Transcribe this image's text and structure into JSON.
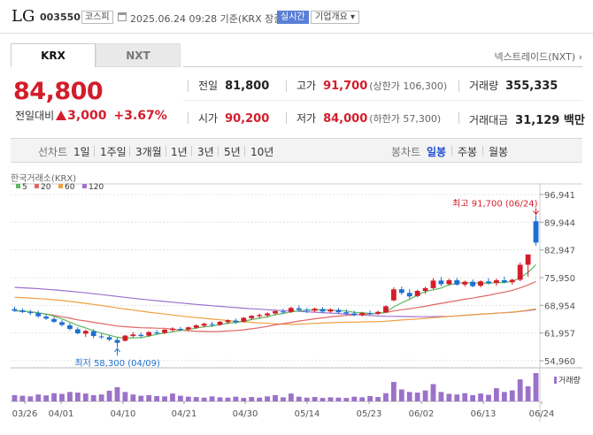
{
  "header": {
    "company_name": "LG",
    "stock_code": "003550",
    "market": "코스피",
    "datetime": "2025.06.24 09:28 기준(KRX 장중)",
    "realtime_label": "실시간",
    "overview_label": "기업개요 ▾"
  },
  "tabs": [
    {
      "label": "KRX",
      "active": true
    },
    {
      "label": "NXT",
      "active": false
    }
  ],
  "nxt_link": "넥스트레이드(NXT) ›",
  "quote": {
    "price": "84,800",
    "change_label": "전일대비",
    "change": "3,000",
    "change_pct": "+3.67%"
  },
  "stats": {
    "prev_close": {
      "label": "전일",
      "value": "81,800"
    },
    "high": {
      "label": "고가",
      "value": "91,700",
      "sub": "(상한가 106,300)"
    },
    "volume": {
      "label": "거래량",
      "value": "355,335"
    },
    "open": {
      "label": "시가",
      "value": "90,200"
    },
    "low": {
      "label": "저가",
      "value": "84,000",
      "sub": "(하한가 57,300)"
    },
    "trade_value": {
      "label": "거래대금",
      "value": "31,129 백만"
    }
  },
  "period_bar": {
    "line_label": "선차트",
    "line_periods": [
      "1일",
      "1주일",
      "3개월",
      "1년",
      "3년",
      "5년",
      "10년"
    ],
    "candle_label": "봉차트",
    "candle_periods": [
      "일봉",
      "주봉",
      "월봉"
    ],
    "candle_active": "일봉"
  },
  "colors": {
    "up": "#d31d2b",
    "down": "#1d6fd1",
    "ma5": "#5cb85c",
    "ma20": "#e06666",
    "ma60": "#f0a040",
    "ma120": "#a070d0",
    "volume": "#9b72c8"
  },
  "chart_data": {
    "type": "candlestick",
    "title": "한국거래소(KRX)",
    "legend": [
      "5",
      "20",
      "60",
      "120"
    ],
    "y_ticks": [
      "96,941",
      "89,944",
      "82,947",
      "75,950",
      "68,954",
      "61,957",
      "54,960"
    ],
    "ylim": [
      54960,
      96941
    ],
    "x_tick_labels": [
      "03/26",
      "04/01",
      "04/10",
      "04/21",
      "04/30",
      "05/14",
      "05/23",
      "06/02",
      "06/13",
      "06/24"
    ],
    "high_annotation": "최고 91,700 (06/24)",
    "low_annotation": "최저 58,300 (04/09)",
    "volume_label": "거래량",
    "candles": [
      {
        "o": 68000,
        "h": 68600,
        "l": 67300,
        "c": 67600
      },
      {
        "o": 67700,
        "h": 68200,
        "l": 67000,
        "c": 67300
      },
      {
        "o": 67200,
        "h": 67800,
        "l": 66500,
        "c": 67100
      },
      {
        "o": 67000,
        "h": 67600,
        "l": 65800,
        "c": 66200
      },
      {
        "o": 66100,
        "h": 66800,
        "l": 65300,
        "c": 65600
      },
      {
        "o": 65500,
        "h": 66000,
        "l": 64500,
        "c": 64800
      },
      {
        "o": 64700,
        "h": 65300,
        "l": 63600,
        "c": 64000
      },
      {
        "o": 63900,
        "h": 64500,
        "l": 62600,
        "c": 63000
      },
      {
        "o": 62900,
        "h": 63400,
        "l": 61600,
        "c": 61900
      },
      {
        "o": 61800,
        "h": 62800,
        "l": 61000,
        "c": 62500
      },
      {
        "o": 62400,
        "h": 62900,
        "l": 60700,
        "c": 61200
      },
      {
        "o": 61100,
        "h": 61800,
        "l": 60500,
        "c": 61000
      },
      {
        "o": 60900,
        "h": 61400,
        "l": 59900,
        "c": 60300
      },
      {
        "o": 60200,
        "h": 60800,
        "l": 58300,
        "c": 59500
      },
      {
        "o": 60000,
        "h": 61500,
        "l": 59800,
        "c": 61300
      },
      {
        "o": 61200,
        "h": 62200,
        "l": 60800,
        "c": 61600
      },
      {
        "o": 61500,
        "h": 62100,
        "l": 60700,
        "c": 61200
      },
      {
        "o": 61300,
        "h": 62400,
        "l": 61000,
        "c": 62200
      },
      {
        "o": 62100,
        "h": 62700,
        "l": 61500,
        "c": 62000
      },
      {
        "o": 62000,
        "h": 63000,
        "l": 61700,
        "c": 62800
      },
      {
        "o": 62700,
        "h": 63400,
        "l": 62200,
        "c": 63100
      },
      {
        "o": 63000,
        "h": 63500,
        "l": 62400,
        "c": 62900
      },
      {
        "o": 62900,
        "h": 63600,
        "l": 62500,
        "c": 63400
      },
      {
        "o": 63300,
        "h": 64200,
        "l": 63000,
        "c": 63900
      },
      {
        "o": 63800,
        "h": 64600,
        "l": 63400,
        "c": 64300
      },
      {
        "o": 64200,
        "h": 64800,
        "l": 63500,
        "c": 64000
      },
      {
        "o": 64000,
        "h": 65000,
        "l": 63800,
        "c": 64800
      },
      {
        "o": 64700,
        "h": 65400,
        "l": 64200,
        "c": 65200
      },
      {
        "o": 65100,
        "h": 65600,
        "l": 64300,
        "c": 64700
      },
      {
        "o": 64800,
        "h": 66000,
        "l": 64600,
        "c": 65800
      },
      {
        "o": 65700,
        "h": 66500,
        "l": 65200,
        "c": 66300
      },
      {
        "o": 66200,
        "h": 66900,
        "l": 65700,
        "c": 66500
      },
      {
        "o": 66400,
        "h": 67200,
        "l": 66000,
        "c": 66900
      },
      {
        "o": 66900,
        "h": 67800,
        "l": 66500,
        "c": 67500
      },
      {
        "o": 67400,
        "h": 68100,
        "l": 66800,
        "c": 67300
      },
      {
        "o": 67300,
        "h": 68600,
        "l": 67000,
        "c": 68300
      },
      {
        "o": 68200,
        "h": 68900,
        "l": 67500,
        "c": 67800
      },
      {
        "o": 67800,
        "h": 68300,
        "l": 67000,
        "c": 67600
      },
      {
        "o": 67600,
        "h": 68400,
        "l": 67200,
        "c": 68100
      },
      {
        "o": 68000,
        "h": 68500,
        "l": 67000,
        "c": 67400
      },
      {
        "o": 67400,
        "h": 68200,
        "l": 67100,
        "c": 67900
      },
      {
        "o": 67800,
        "h": 68300,
        "l": 66900,
        "c": 67200
      },
      {
        "o": 67200,
        "h": 67900,
        "l": 66500,
        "c": 66900
      },
      {
        "o": 66900,
        "h": 67600,
        "l": 66200,
        "c": 66500
      },
      {
        "o": 66500,
        "h": 67300,
        "l": 66100,
        "c": 67000
      },
      {
        "o": 67000,
        "h": 67600,
        "l": 66400,
        "c": 66800
      },
      {
        "o": 66800,
        "h": 67600,
        "l": 66500,
        "c": 67300
      },
      {
        "o": 67200,
        "h": 69000,
        "l": 67000,
        "c": 68700
      },
      {
        "o": 70200,
        "h": 73500,
        "l": 70000,
        "c": 73000
      },
      {
        "o": 73000,
        "h": 73700,
        "l": 71600,
        "c": 72100
      },
      {
        "o": 72100,
        "h": 73000,
        "l": 70600,
        "c": 71200
      },
      {
        "o": 71300,
        "h": 72900,
        "l": 71000,
        "c": 72600
      },
      {
        "o": 72600,
        "h": 73700,
        "l": 71800,
        "c": 73300
      },
      {
        "o": 73300,
        "h": 75800,
        "l": 73000,
        "c": 75200
      },
      {
        "o": 75200,
        "h": 76100,
        "l": 73800,
        "c": 74300
      },
      {
        "o": 74300,
        "h": 75700,
        "l": 74000,
        "c": 75300
      },
      {
        "o": 75300,
        "h": 75900,
        "l": 73900,
        "c": 74200
      },
      {
        "o": 74200,
        "h": 75200,
        "l": 73700,
        "c": 74900
      },
      {
        "o": 74900,
        "h": 75500,
        "l": 73500,
        "c": 73800
      },
      {
        "o": 73900,
        "h": 75300,
        "l": 73500,
        "c": 75000
      },
      {
        "o": 75000,
        "h": 75800,
        "l": 74200,
        "c": 74600
      },
      {
        "o": 74600,
        "h": 75700,
        "l": 73900,
        "c": 75300
      },
      {
        "o": 75300,
        "h": 76200,
        "l": 74500,
        "c": 74800
      },
      {
        "o": 74800,
        "h": 75700,
        "l": 74200,
        "c": 75400
      },
      {
        "o": 75400,
        "h": 79800,
        "l": 75000,
        "c": 79200
      },
      {
        "o": 79200,
        "h": 81200,
        "l": 76200,
        "c": 81800
      },
      {
        "o": 90200,
        "h": 91700,
        "l": 84000,
        "c": 84800
      }
    ],
    "volumes": [
      20,
      18,
      16,
      22,
      19,
      26,
      24,
      30,
      28,
      25,
      20,
      22,
      34,
      45,
      30,
      22,
      18,
      20,
      17,
      16,
      25,
      18,
      15,
      14,
      12,
      16,
      13,
      12,
      15,
      11,
      14,
      12,
      16,
      20,
      13,
      25,
      15,
      12,
      14,
      11,
      13,
      12,
      11,
      15,
      13,
      17,
      14,
      26,
      62,
      38,
      30,
      28,
      35,
      55,
      30,
      24,
      22,
      26,
      20,
      25,
      21,
      42,
      30,
      35,
      70,
      48,
      90
    ]
  }
}
